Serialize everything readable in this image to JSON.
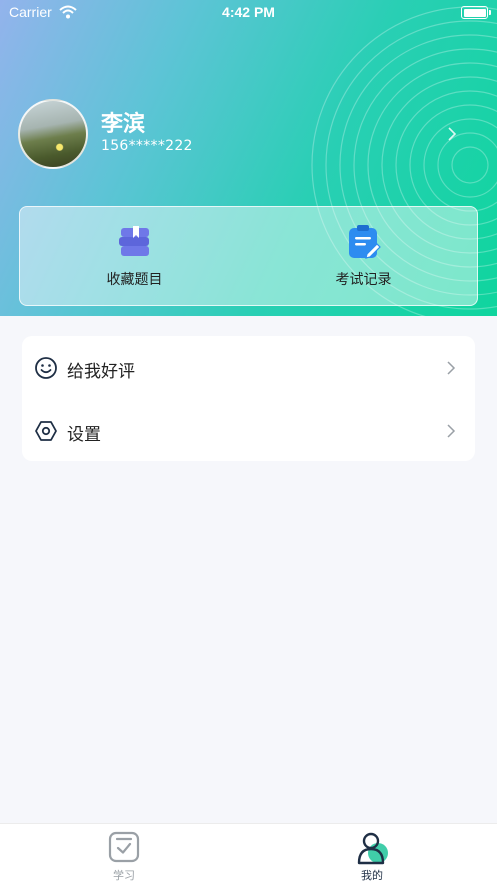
{
  "status_bar": {
    "carrier": "Carrier",
    "time": "4:42 PM"
  },
  "profile": {
    "name": "李滨",
    "phone": "156*****222"
  },
  "quick_actions": [
    {
      "label": "收藏题目",
      "icon": "bookmark-book-icon"
    },
    {
      "label": "考试记录",
      "icon": "clipboard-edit-icon"
    }
  ],
  "menu": [
    {
      "label": "给我好评",
      "icon": "smiley-icon"
    },
    {
      "label": "设置",
      "icon": "hexagon-settings-icon"
    }
  ],
  "tabs": [
    {
      "label": "学习",
      "icon": "study-check-icon",
      "active": false
    },
    {
      "label": "我的",
      "icon": "person-icon",
      "active": true
    }
  ],
  "colors": {
    "accent": "#1fc49a",
    "active_tab": "#1f2f45",
    "inactive_tab": "#9aa0a6",
    "quick_icon_purple": "#6f78e8",
    "quick_icon_blue": "#2d8cf0"
  }
}
